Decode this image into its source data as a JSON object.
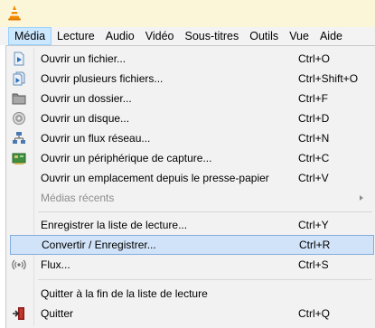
{
  "menubar": {
    "items": [
      {
        "label": "Média"
      },
      {
        "label": "Lecture"
      },
      {
        "label": "Audio"
      },
      {
        "label": "Vidéo"
      },
      {
        "label": "Sous-titres"
      },
      {
        "label": "Outils"
      },
      {
        "label": "Vue"
      },
      {
        "label": "Aide"
      }
    ]
  },
  "media_menu": {
    "items": [
      {
        "label": "Ouvrir un fichier...",
        "shortcut": "Ctrl+O",
        "icon": "file-icon"
      },
      {
        "label": "Ouvrir plusieurs fichiers...",
        "shortcut": "Ctrl+Shift+O",
        "icon": "files-icon"
      },
      {
        "label": "Ouvrir un dossier...",
        "shortcut": "Ctrl+F",
        "icon": "folder-icon"
      },
      {
        "label": "Ouvrir un disque...",
        "shortcut": "Ctrl+D",
        "icon": "disc-icon"
      },
      {
        "label": "Ouvrir un flux réseau...",
        "shortcut": "Ctrl+N",
        "icon": "network-icon"
      },
      {
        "label": "Ouvrir un périphérique de capture...",
        "shortcut": "Ctrl+C",
        "icon": "capture-card-icon"
      },
      {
        "label": "Ouvrir un emplacement depuis le presse-papier",
        "shortcut": "Ctrl+V"
      },
      {
        "label": "Médias récents",
        "shortcut": "",
        "disabled": true,
        "submenu": true
      },
      {
        "label": "Enregistrer la liste de lecture...",
        "shortcut": "Ctrl+Y"
      },
      {
        "label": "Convertir / Enregistrer...",
        "shortcut": "Ctrl+R",
        "highlighted": true
      },
      {
        "label": "Flux...",
        "shortcut": "Ctrl+S",
        "icon": "stream-icon"
      },
      {
        "label": "Quitter à la fin de la liste de lecture",
        "shortcut": ""
      },
      {
        "label": "Quitter",
        "shortcut": "Ctrl+Q",
        "icon": "exit-icon"
      }
    ]
  },
  "colors": {
    "highlight_bg": "#d1e3f8",
    "highlight_border": "#84acdd",
    "active_menu_bg": "#cce8ff",
    "titlebar_bg": "#fbf6d7",
    "disabled_text": "#8d8d8d"
  }
}
